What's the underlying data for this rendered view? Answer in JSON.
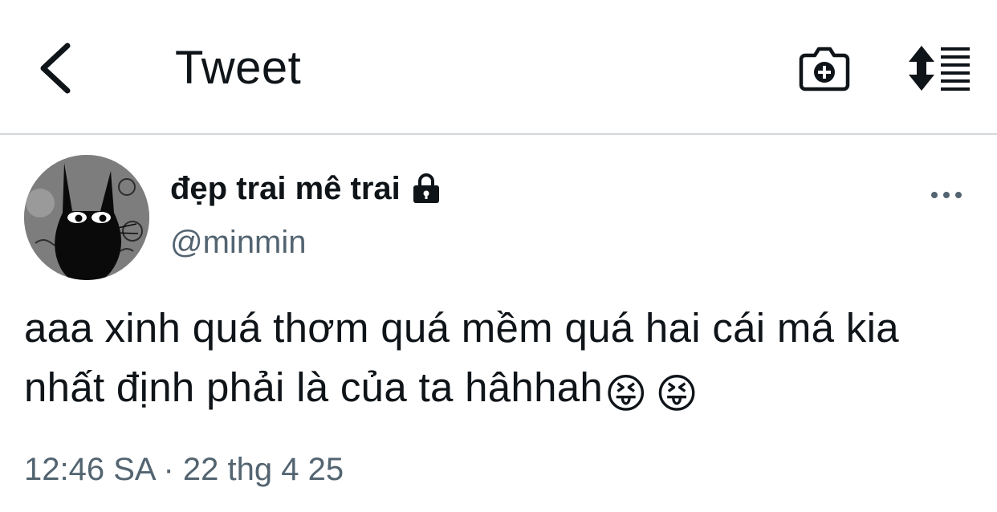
{
  "header": {
    "back_icon": "chevron-left-icon",
    "title": "Tweet",
    "camera_icon": "camera-plus-icon",
    "sort_icon": "sort-list-icon"
  },
  "tweet": {
    "author": {
      "display_name": "đẹp trai mê trai",
      "protected_icon": "lock-icon",
      "handle": "@minmin",
      "avatar": "black-cat-avatar"
    },
    "more_icon": "more-horizontal-icon",
    "text_line1": "aaa xinh quá thơm quá mềm quá hai cái má kia",
    "text_line2": "nhất định phải là của ta hâhhah",
    "emojis": [
      "😝",
      "😝"
    ],
    "timestamp": "12:46 SA · 22 thg 4 25"
  },
  "colors": {
    "text": "#0f1419",
    "secondary_text": "#536471",
    "divider": "#d4d7da",
    "background": "#ffffff"
  }
}
